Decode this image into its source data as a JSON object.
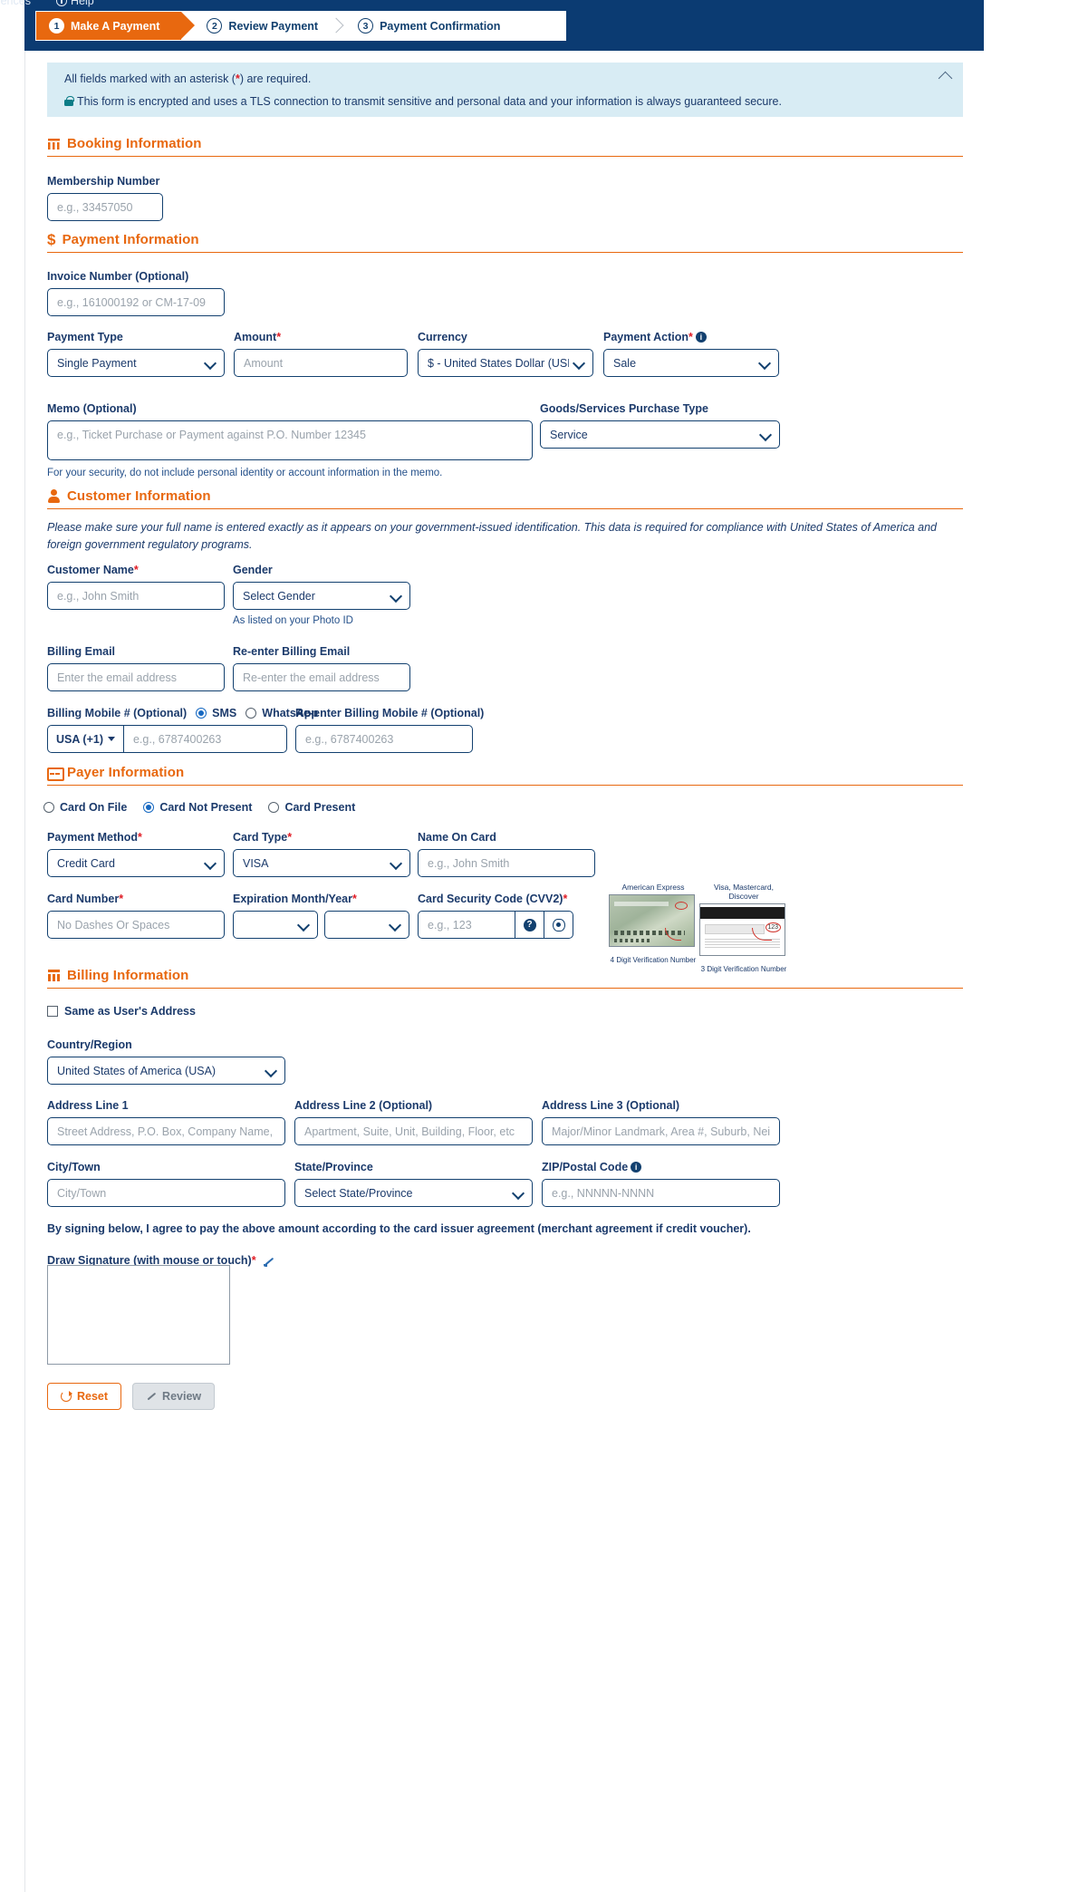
{
  "topnav": {
    "preferences": "ferences",
    "help": "Help"
  },
  "wizard": {
    "steps": [
      {
        "num": "1",
        "label": "Make A Payment",
        "state": "active"
      },
      {
        "num": "2",
        "label": "Review Payment",
        "state": "idle"
      },
      {
        "num": "3",
        "label": "Payment Confirmation",
        "state": "idle"
      }
    ]
  },
  "callout": {
    "required_note_pre": "All fields marked with an asterisk (",
    "required_note_star": "*",
    "required_note_post": ") are required.",
    "security_note": "This form is encrypted and uses a TLS connection to transmit sensitive and personal data and your information is always guaranteed secure."
  },
  "booking": {
    "title": "Booking Information",
    "membership_label": "Membership Number",
    "membership_placeholder": "e.g., 33457050",
    "membership_value": ""
  },
  "payment": {
    "title": "Payment Information",
    "invoice_label": "Invoice Number (Optional)",
    "invoice_placeholder": "e.g., 161000192 or CM-17-09",
    "invoice_value": "",
    "payment_type_label": "Payment Type",
    "payment_type_value": "Single Payment",
    "amount_label": "Amount",
    "amount_placeholder": "Amount",
    "amount_value": "",
    "currency_label": "Currency",
    "currency_value": "$ - United States Dollar (USD)",
    "payment_action_label": "Payment Action",
    "payment_action_value": "Sale",
    "memo_label": "Memo (Optional)",
    "memo_placeholder": "e.g., Ticket Purchase or Payment against P.O. Number 12345",
    "memo_value": "",
    "memo_hint": "For your security, do not include personal identity or account information in the memo.",
    "goods_label": "Goods/Services Purchase Type",
    "goods_value": "Service"
  },
  "customer": {
    "title": "Customer Information",
    "note": "Please make sure your full name is entered exactly as it appears on your government-issued identification. This data is required for compliance with United States of America and foreign government regulatory programs.",
    "name_label": "Customer Name",
    "name_placeholder": "e.g., John Smith",
    "name_value": "",
    "gender_label": "Gender",
    "gender_value": "Select Gender",
    "gender_hint": "As listed on your Photo ID",
    "email_label": "Billing Email",
    "email_placeholder": "Enter the email address",
    "email_value": "",
    "reemail_label": "Re-enter Billing Email",
    "reemail_placeholder": "Re-enter the email address",
    "reemail_value": "",
    "mobile_label": "Billing Mobile # (Optional)",
    "sms_label": "SMS",
    "whatsapp_label": "WhatsApp",
    "country_code": "USA (+1)",
    "mobile_placeholder": "e.g., 6787400263",
    "mobile_value": "",
    "remobile_label": "Re-enter Billing Mobile # (Optional)",
    "remobile_placeholder": "e.g., 6787400263",
    "remobile_value": ""
  },
  "payer": {
    "title": "Payer Information",
    "presence_options": [
      {
        "label": "Card On File",
        "selected": false
      },
      {
        "label": "Card Not Present",
        "selected": true
      },
      {
        "label": "Card Present",
        "selected": false
      }
    ],
    "payment_method_label": "Payment Method",
    "payment_method_value": "Credit Card",
    "card_type_label": "Card Type",
    "card_type_value": "VISA",
    "name_on_card_label": "Name On Card",
    "name_on_card_placeholder": "e.g., John Smith",
    "name_on_card_value": "",
    "card_number_label": "Card Number",
    "card_number_placeholder": "No Dashes Or Spaces",
    "card_number_value": "",
    "expiration_label": "Expiration Month/Year",
    "exp_month_value": "",
    "exp_year_value": "",
    "cvv_label": "Card Security Code (CVV2)",
    "cvv_placeholder": "e.g., 123",
    "cvv_value": "",
    "amex_caption_top": "American Express",
    "amex_caption_bottom": "4 Digit Verification Number",
    "visa_caption_top": "Visa, Mastercard, Discover",
    "visa_caption_bottom": "3 Digit Verification Number"
  },
  "billing": {
    "title": "Billing Information",
    "same_as_user_label": "Same as User's Address",
    "country_label": "Country/Region",
    "country_value": "United States of America (USA)",
    "address1_label": "Address Line 1",
    "address1_placeholder": "Street Address, P.O. Box, Company Name, c/o",
    "address1_value": "",
    "address2_label": "Address Line 2 (Optional)",
    "address2_placeholder": "Apartment, Suite, Unit, Building, Floor, etc",
    "address2_value": "",
    "address3_label": "Address Line 3 (Optional)",
    "address3_placeholder": "Major/Minor Landmark, Area #, Suburb, Neighborhood",
    "address3_value": "",
    "city_label": "City/Town",
    "city_placeholder": "City/Town",
    "city_value": "",
    "state_label": "State/Province",
    "state_value": "Select State/Province",
    "zip_label": "ZIP/Postal Code",
    "zip_placeholder": "e.g., NNNNN-NNNN",
    "zip_value": ""
  },
  "signature": {
    "agreement": "By signing below, I agree to pay the above amount according to the card issuer agreement (merchant agreement if credit voucher).",
    "label": "Draw Signature (with mouse or touch)"
  },
  "actions": {
    "reset_label": "Reset",
    "review_label": "Review"
  },
  "colors": {
    "brand_orange": "#e8680f",
    "brand_navy": "#0b3b72",
    "callout_bg": "#d8ecf4",
    "required_red": "#e01b24"
  }
}
